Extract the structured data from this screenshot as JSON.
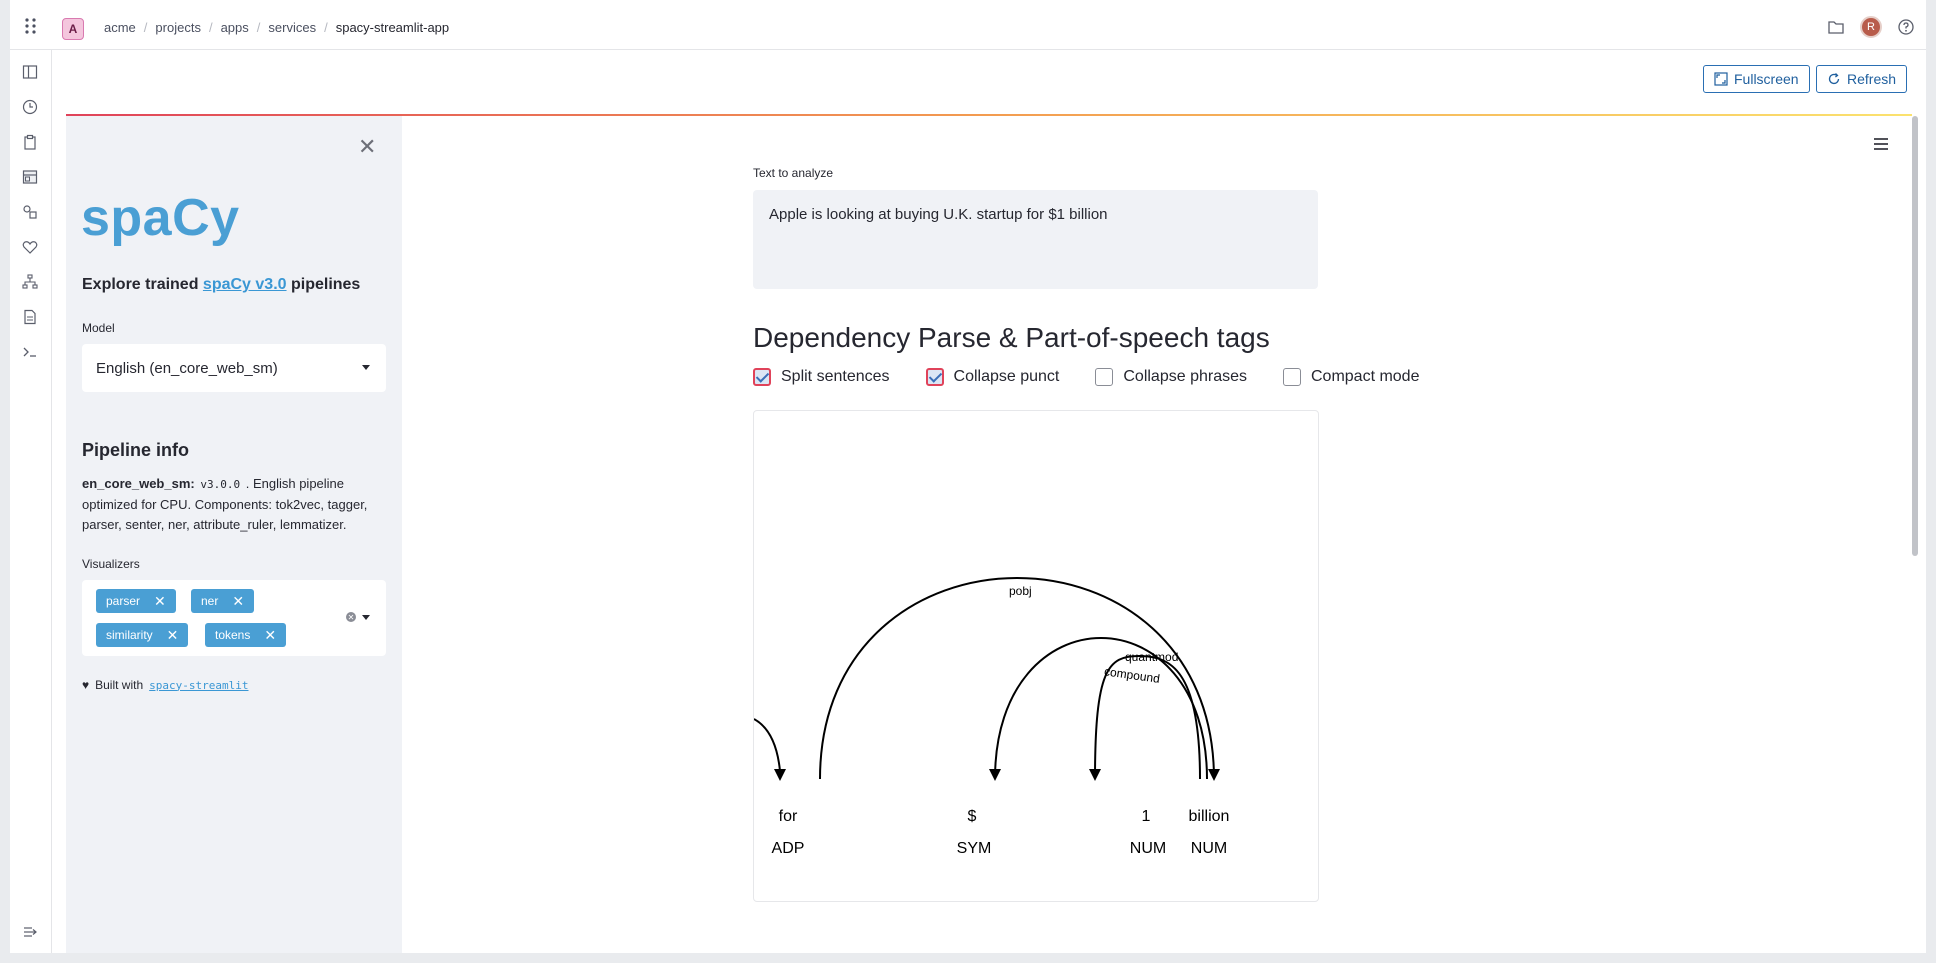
{
  "topbar": {
    "workspace_badge": "A",
    "breadcrumbs": [
      "acme",
      "projects",
      "apps",
      "services"
    ],
    "current": "spacy-streamlit-app",
    "avatar": "R"
  },
  "toolbar": {
    "fullscreen_label": "Fullscreen",
    "refresh_label": "Refresh"
  },
  "sidebar": {
    "logo": "spaCy",
    "explore_prefix": "Explore trained ",
    "explore_link": "spaCy v3.0",
    "explore_suffix": " pipelines",
    "model_label": "Model",
    "model_value": "English (en_core_web_sm)",
    "pipeline_title": "Pipeline info",
    "pipeline_name": "en_core_web_sm:",
    "pipeline_version": "v3.0.0",
    "pipeline_desc": ". English pipeline optimized for CPU. Components: tok2vec, tagger, parser, senter, ner, attribute_ruler, lemmatizer.",
    "visualizers_label": "Visualizers",
    "visualizers": [
      "parser",
      "ner",
      "similarity",
      "tokens"
    ],
    "built_prefix": "Built with",
    "built_link": "spacy-streamlit"
  },
  "content": {
    "text_label": "Text to analyze",
    "text_value": "Apple is looking at buying U.K. startup for $1 billion",
    "section_title": "Dependency Parse & Part-of-speech tags",
    "options": [
      {
        "label": "Split sentences",
        "checked": true
      },
      {
        "label": "Collapse punct",
        "checked": true
      },
      {
        "label": "Collapse phrases",
        "checked": false
      },
      {
        "label": "Compact mode",
        "checked": false
      }
    ]
  },
  "parse": {
    "tokens": [
      {
        "word": "for",
        "tag": "ADP"
      },
      {
        "word": "$",
        "tag": "SYM"
      },
      {
        "word": "1",
        "tag": "NUM"
      },
      {
        "word": "billion",
        "tag": "NUM"
      }
    ],
    "arcs": [
      {
        "label": "pobj",
        "head": "for",
        "dep": "billion"
      },
      {
        "label": "quantmod",
        "head": "billion",
        "dep": "$"
      },
      {
        "label": "compound",
        "head": "billion",
        "dep": "1"
      }
    ]
  }
}
